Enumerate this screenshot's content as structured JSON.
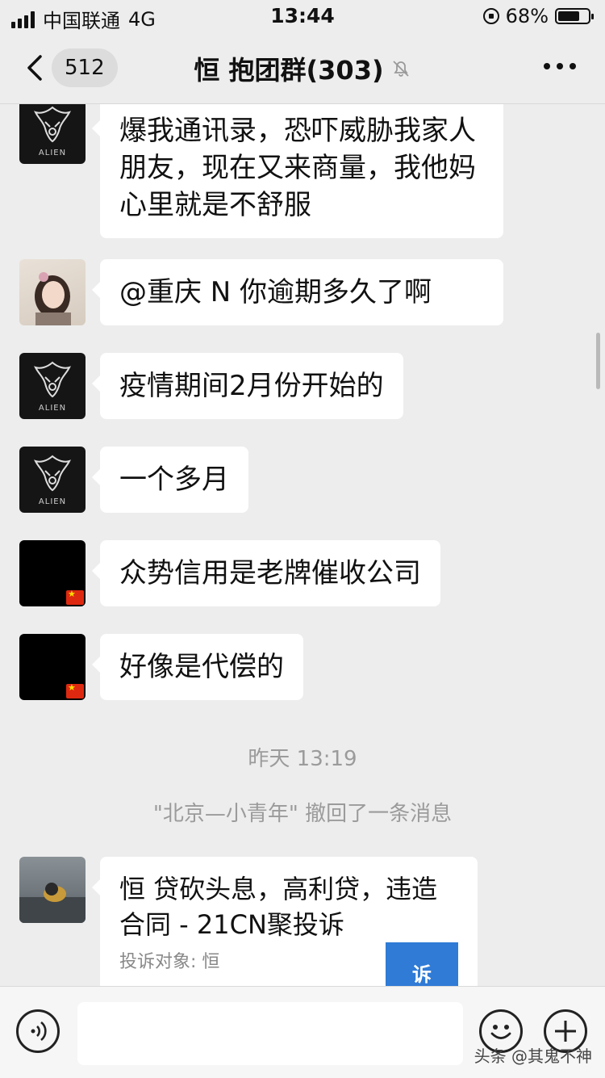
{
  "status_bar": {
    "carrier": "中国联通",
    "network": "4G",
    "time": "13:44",
    "battery": "68%"
  },
  "nav": {
    "back_count": "512",
    "title": "恒 抱团群(303)"
  },
  "messages": [
    {
      "text": "爆我通讯录，恐吓威胁我家人朋友，现在又来商量，我他妈心里就是不舒服"
    },
    {
      "text": "@重庆 N 你逾期多久了啊"
    },
    {
      "text": "疫情期间2月份开始的"
    },
    {
      "text": "一个多月"
    },
    {
      "text": "众势信用是老牌催收公司"
    },
    {
      "text": "好像是代偿的"
    }
  ],
  "system": {
    "timestamp": "昨天 13:19",
    "recall": "\"北京—小青年\" 撤回了一条消息"
  },
  "card": {
    "title": "恒 贷砍头息，高利贷，违造合同 - 21CN聚投诉",
    "subtitle": "投诉对象: 恒",
    "thumb_text": "诉"
  },
  "avatars": {
    "alien_brand": "ALIEN"
  },
  "watermark": "头条 @其鬼不神",
  "colors": {
    "background": "#ededed",
    "bubble": "#ffffff",
    "system_text": "#9b9b9b"
  }
}
